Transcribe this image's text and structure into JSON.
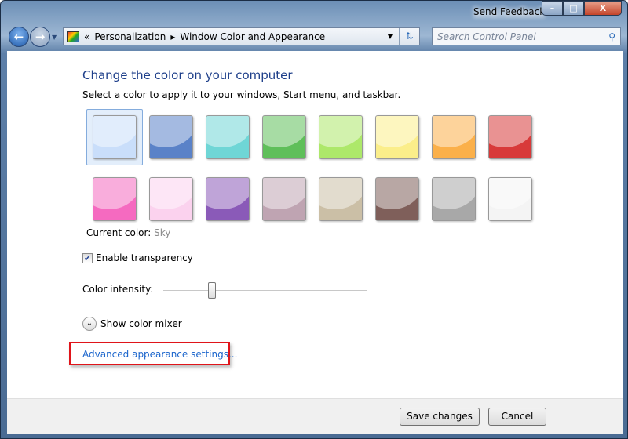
{
  "window": {
    "send_feedback": "Send Feedback",
    "minimize": "–",
    "maximize": "□",
    "close": "X"
  },
  "address": {
    "chevron": "«",
    "crumbs": [
      "Personalization",
      "Window Color and Appearance"
    ],
    "separator": "▸"
  },
  "search": {
    "placeholder": "Search Control Panel"
  },
  "main": {
    "title": "Change the color on your computer",
    "subtitle": "Select a color to apply it to your windows, Start menu, and taskbar.",
    "swatches": [
      "#c9defa",
      "#5a82c8",
      "#6fd6d6",
      "#5fbf5a",
      "#ade86a",
      "#fbee8a",
      "#fbb04a",
      "#d83a3a",
      "#f56ac0",
      "#fbd2ee",
      "#8a5ab8",
      "#bfa4b2",
      "#cbbfa6",
      "#7f5f5a",
      "#a8a8a8",
      "#f4f4f4"
    ],
    "selected_index": 0,
    "current_color_label": "Current color:",
    "current_color_value": "Sky",
    "transparency_label": "Enable transparency",
    "transparency_checked": true,
    "intensity_label": "Color intensity:",
    "intensity_percent": 24,
    "mixer_label": "Show color mixer",
    "advanced_link": "Advanced appearance settings..."
  },
  "footer": {
    "save": "Save changes",
    "cancel": "Cancel"
  },
  "colors": {
    "highlight": "#e0141a",
    "link": "#1b65cc",
    "title": "#1e3f8a"
  }
}
